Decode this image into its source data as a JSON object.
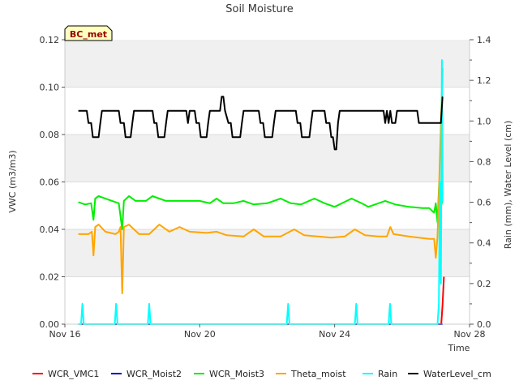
{
  "chart_data": {
    "type": "line",
    "title": "Soil Moisture",
    "xlabel": "Time",
    "ylabel_left": "VWC (m3/m3)",
    "ylabel_right": "Rain (mm), Water Level (cm)",
    "station_label": "BC_met",
    "x_ticks": [
      "Nov 16",
      "Nov 20",
      "Nov 24",
      "Nov 28"
    ],
    "y_left_ticks": [
      "0.00",
      "0.02",
      "0.04",
      "0.06",
      "0.08",
      "0.10",
      "0.12"
    ],
    "y_right_ticks": [
      "0.0",
      "0.2",
      "0.4",
      "0.6",
      "0.8",
      "1.0",
      "1.2",
      "1.4"
    ],
    "xlim_days": [
      0,
      12
    ],
    "ylim_left": [
      0,
      0.12
    ],
    "ylim_right": [
      0,
      1.4
    ],
    "grid": "horizontal bands",
    "legend_position": "bottom",
    "series": [
      {
        "name": "WCR_VMC1",
        "axis": "left",
        "color": "#ff0000",
        "points": [
          [
            11.16,
            0.0
          ],
          [
            11.2,
            0.008
          ],
          [
            11.24,
            0.02
          ]
        ]
      },
      {
        "name": "WCR_Moist2",
        "axis": "left",
        "color": "#0000cc",
        "points": [
          [
            0.4,
            0.0
          ],
          [
            11.2,
            0.0
          ]
        ]
      },
      {
        "name": "WCR_Moist3",
        "axis": "left",
        "color": "#00ee00",
        "points": [
          [
            0.4,
            0.0515
          ],
          [
            0.6,
            0.0505
          ],
          [
            0.78,
            0.051
          ],
          [
            0.85,
            0.044
          ],
          [
            0.9,
            0.053
          ],
          [
            1.0,
            0.054
          ],
          [
            1.2,
            0.053
          ],
          [
            1.4,
            0.052
          ],
          [
            1.6,
            0.051
          ],
          [
            1.7,
            0.04
          ],
          [
            1.75,
            0.052
          ],
          [
            1.9,
            0.054
          ],
          [
            2.1,
            0.052
          ],
          [
            2.4,
            0.052
          ],
          [
            2.6,
            0.054
          ],
          [
            2.8,
            0.053
          ],
          [
            3.0,
            0.052
          ],
          [
            4.0,
            0.052
          ],
          [
            4.3,
            0.051
          ],
          [
            4.5,
            0.053
          ],
          [
            4.7,
            0.051
          ],
          [
            5.0,
            0.051
          ],
          [
            5.3,
            0.052
          ],
          [
            5.6,
            0.0505
          ],
          [
            6.0,
            0.051
          ],
          [
            6.4,
            0.053
          ],
          [
            6.7,
            0.051
          ],
          [
            7.0,
            0.0505
          ],
          [
            7.4,
            0.053
          ],
          [
            7.7,
            0.051
          ],
          [
            8.0,
            0.0495
          ],
          [
            8.5,
            0.053
          ],
          [
            8.8,
            0.051
          ],
          [
            9.0,
            0.0495
          ],
          [
            9.5,
            0.052
          ],
          [
            9.8,
            0.0505
          ],
          [
            10.2,
            0.0495
          ],
          [
            10.6,
            0.049
          ],
          [
            10.8,
            0.049
          ],
          [
            10.95,
            0.047
          ],
          [
            11.0,
            0.051
          ],
          [
            11.05,
            0.043
          ],
          [
            11.1,
            0.06
          ],
          [
            11.15,
            0.05
          ],
          [
            11.2,
            0.052
          ]
        ]
      },
      {
        "name": "Theta_moist",
        "axis": "left",
        "color": "#ffa500",
        "points": [
          [
            0.4,
            0.038
          ],
          [
            0.7,
            0.038
          ],
          [
            0.8,
            0.039
          ],
          [
            0.85,
            0.029
          ],
          [
            0.9,
            0.041
          ],
          [
            1.0,
            0.042
          ],
          [
            1.2,
            0.039
          ],
          [
            1.5,
            0.038
          ],
          [
            1.6,
            0.039
          ],
          [
            1.65,
            0.041
          ],
          [
            1.7,
            0.013
          ],
          [
            1.75,
            0.041
          ],
          [
            1.9,
            0.042
          ],
          [
            2.2,
            0.038
          ],
          [
            2.5,
            0.038
          ],
          [
            2.8,
            0.042
          ],
          [
            3.1,
            0.039
          ],
          [
            3.4,
            0.041
          ],
          [
            3.7,
            0.039
          ],
          [
            4.2,
            0.0385
          ],
          [
            4.5,
            0.039
          ],
          [
            4.8,
            0.0375
          ],
          [
            5.3,
            0.037
          ],
          [
            5.6,
            0.04
          ],
          [
            5.9,
            0.037
          ],
          [
            6.4,
            0.037
          ],
          [
            6.8,
            0.04
          ],
          [
            7.1,
            0.0375
          ],
          [
            7.5,
            0.037
          ],
          [
            7.9,
            0.0365
          ],
          [
            8.3,
            0.037
          ],
          [
            8.6,
            0.04
          ],
          [
            8.9,
            0.0375
          ],
          [
            9.3,
            0.037
          ],
          [
            9.55,
            0.037
          ],
          [
            9.65,
            0.041
          ],
          [
            9.75,
            0.038
          ],
          [
            10.2,
            0.037
          ],
          [
            10.8,
            0.036
          ],
          [
            10.95,
            0.036
          ],
          [
            11.0,
            0.028
          ],
          [
            11.05,
            0.037
          ],
          [
            11.1,
            0.06
          ],
          [
            11.2,
            0.108
          ]
        ]
      },
      {
        "name": "Rain",
        "axis": "right",
        "color": "#00ffff",
        "points": [
          [
            0.4,
            0.0
          ],
          [
            0.48,
            0.0
          ],
          [
            0.52,
            0.1
          ],
          [
            0.56,
            0.0
          ],
          [
            1.48,
            0.0
          ],
          [
            1.52,
            0.1
          ],
          [
            1.56,
            0.0
          ],
          [
            2.46,
            0.0
          ],
          [
            2.5,
            0.1
          ],
          [
            2.54,
            0.0
          ],
          [
            6.58,
            0.0
          ],
          [
            6.62,
            0.1
          ],
          [
            6.66,
            0.0
          ],
          [
            8.6,
            0.0
          ],
          [
            8.64,
            0.1
          ],
          [
            8.68,
            0.0
          ],
          [
            9.6,
            0.0
          ],
          [
            9.64,
            0.1
          ],
          [
            9.68,
            0.0
          ],
          [
            11.05,
            0.0
          ],
          [
            11.09,
            0.1
          ],
          [
            11.12,
            0.7
          ],
          [
            11.15,
            0.2
          ],
          [
            11.18,
            1.3
          ],
          [
            11.2,
            0.6
          ]
        ]
      },
      {
        "name": "WaterLevel_cm",
        "axis": "right",
        "color": "#000000",
        "points": [
          [
            0.4,
            1.05
          ],
          [
            0.65,
            1.05
          ],
          [
            0.7,
            0.99
          ],
          [
            0.78,
            0.99
          ],
          [
            0.83,
            0.92
          ],
          [
            1.0,
            0.92
          ],
          [
            1.05,
            0.99
          ],
          [
            1.1,
            1.05
          ],
          [
            1.6,
            1.05
          ],
          [
            1.65,
            0.99
          ],
          [
            1.75,
            0.99
          ],
          [
            1.8,
            0.92
          ],
          [
            1.95,
            0.92
          ],
          [
            2.0,
            0.99
          ],
          [
            2.05,
            1.05
          ],
          [
            2.6,
            1.05
          ],
          [
            2.65,
            0.99
          ],
          [
            2.72,
            0.99
          ],
          [
            2.77,
            0.92
          ],
          [
            2.95,
            0.92
          ],
          [
            3.0,
            0.99
          ],
          [
            3.05,
            1.05
          ],
          [
            3.6,
            1.05
          ],
          [
            3.65,
            0.99
          ],
          [
            3.7,
            1.05
          ],
          [
            3.85,
            1.05
          ],
          [
            3.9,
            0.99
          ],
          [
            3.98,
            0.99
          ],
          [
            4.03,
            0.92
          ],
          [
            4.2,
            0.92
          ],
          [
            4.25,
            0.99
          ],
          [
            4.3,
            1.05
          ],
          [
            4.6,
            1.05
          ],
          [
            4.65,
            1.12
          ],
          [
            4.7,
            1.12
          ],
          [
            4.75,
            1.05
          ],
          [
            4.85,
            0.99
          ],
          [
            4.92,
            0.99
          ],
          [
            4.97,
            0.92
          ],
          [
            5.2,
            0.92
          ],
          [
            5.25,
            0.99
          ],
          [
            5.3,
            1.05
          ],
          [
            5.75,
            1.05
          ],
          [
            5.8,
            0.99
          ],
          [
            5.88,
            0.99
          ],
          [
            5.93,
            0.92
          ],
          [
            6.15,
            0.92
          ],
          [
            6.2,
            0.99
          ],
          [
            6.25,
            1.05
          ],
          [
            6.85,
            1.05
          ],
          [
            6.9,
            0.99
          ],
          [
            6.98,
            0.99
          ],
          [
            7.03,
            0.92
          ],
          [
            7.25,
            0.92
          ],
          [
            7.3,
            0.99
          ],
          [
            7.35,
            1.05
          ],
          [
            7.7,
            1.05
          ],
          [
            7.75,
            0.99
          ],
          [
            7.85,
            0.99
          ],
          [
            7.9,
            0.92
          ],
          [
            7.95,
            0.92
          ],
          [
            8.0,
            0.86
          ],
          [
            8.05,
            0.86
          ],
          [
            8.1,
            0.99
          ],
          [
            8.15,
            1.05
          ],
          [
            9.45,
            1.05
          ],
          [
            9.5,
            0.99
          ],
          [
            9.55,
            1.05
          ],
          [
            9.6,
            0.99
          ],
          [
            9.65,
            1.05
          ],
          [
            9.7,
            0.99
          ],
          [
            9.8,
            0.99
          ],
          [
            9.85,
            1.05
          ],
          [
            10.45,
            1.05
          ],
          [
            10.5,
            0.99
          ],
          [
            11.0,
            0.99
          ],
          [
            11.15,
            0.99
          ],
          [
            11.2,
            1.12
          ]
        ]
      }
    ]
  }
}
